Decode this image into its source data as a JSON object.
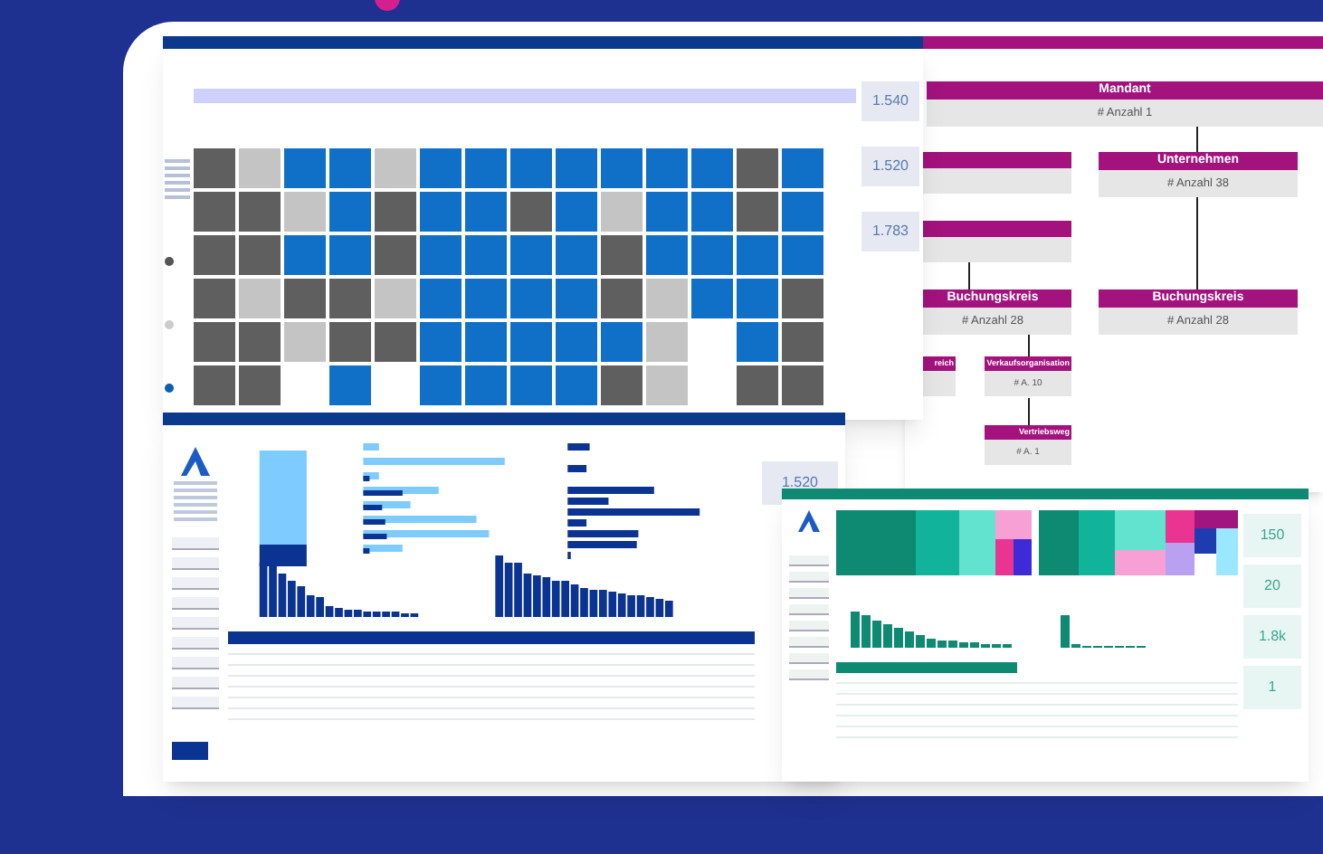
{
  "tile_window": {
    "kpis": [
      {
        "value": "1.540"
      },
      {
        "value": "1.520"
      },
      {
        "value": "1.783"
      }
    ]
  },
  "org_chart": {
    "nodes": [
      {
        "title": "Mandant",
        "count": "# Anzahl 1"
      },
      {
        "title": "Unternehmen",
        "count": "# Anzahl 38"
      },
      {
        "title": "Buchungskreis",
        "count": "# Anzahl 28"
      },
      {
        "title": "Buchungskreis",
        "count": "# Anzahl 28"
      },
      {
        "title": "reich"
      },
      {
        "title": "Verkaufsorganisation",
        "count": "# A. 10"
      },
      {
        "title": "Vertriebsweg",
        "count": "# A. 1"
      }
    ]
  },
  "dashboard_window": {
    "kpis": [
      {
        "value": "1.520"
      }
    ]
  },
  "green_window": {
    "kpis": [
      {
        "value": "150"
      },
      {
        "value": "20"
      },
      {
        "value": "1.8k"
      },
      {
        "value": "1"
      }
    ]
  }
}
